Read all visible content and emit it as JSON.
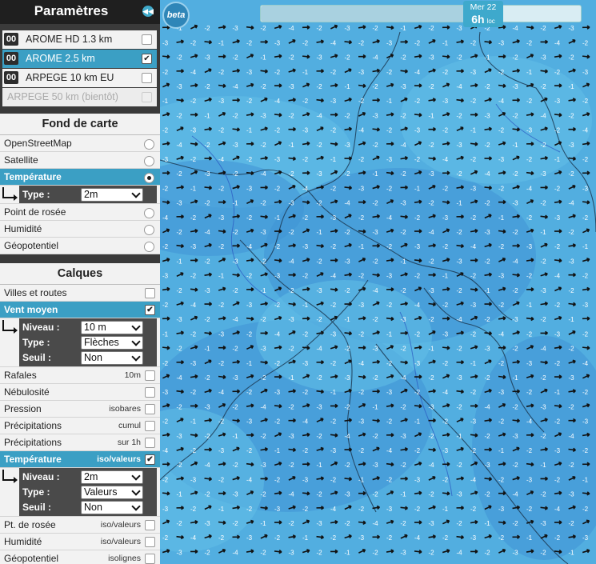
{
  "panel": {
    "title": "Paramètres",
    "models": [
      {
        "run": "00",
        "label": "AROME HD 1.3 km",
        "checked": false,
        "selected": false,
        "disabled": false
      },
      {
        "run": "00",
        "label": "AROME 2.5 km",
        "checked": true,
        "selected": true,
        "disabled": false
      },
      {
        "run": "00",
        "label": "ARPEGE 10 km EU",
        "checked": false,
        "selected": false,
        "disabled": false
      },
      {
        "run": "",
        "label": "ARPEGE 50 km (bientôt)",
        "checked": false,
        "selected": false,
        "disabled": true
      }
    ],
    "basemap": {
      "title": "Fond de carte",
      "options": [
        "OpenStreetMap",
        "Satellite",
        "Température",
        "Point de rosée",
        "Humidité",
        "Géopotentiel"
      ],
      "selected": "Température",
      "type_label": "Type :",
      "type_value": "2m"
    },
    "layers": {
      "title": "Calques",
      "villes": "Villes et routes",
      "vent": {
        "label": "Vent moyen",
        "niveau_label": "Niveau :",
        "niveau_value": "10 m",
        "type_label": "Type :",
        "type_value": "Flèches",
        "seuil_label": "Seuil :",
        "seuil_value": "Non"
      },
      "rafales": {
        "label": "Rafales",
        "hint": "10m"
      },
      "nebulosite": {
        "label": "Nébulosité",
        "hint": ""
      },
      "pression": {
        "label": "Pression",
        "hint": "isobares"
      },
      "precip_cumul": {
        "label": "Précipitations",
        "hint": "cumul"
      },
      "precip_1h": {
        "label": "Précipitations",
        "hint": "sur 1h"
      },
      "temperature": {
        "label": "Température",
        "hint": "iso/valeurs",
        "niveau_label": "Niveau :",
        "niveau_value": "2m",
        "type_label": "Type :",
        "type_value": "Valeurs",
        "seuil_label": "Seuil :",
        "seuil_value": "Non"
      },
      "pt_rosee": {
        "label": "Pt. de rosée",
        "hint": "iso/valeurs"
      },
      "humidite": {
        "label": "Humidité",
        "hint": "iso/valeurs"
      },
      "geopotentiel": {
        "label": "Géopotentiel",
        "hint": "isolignes"
      }
    }
  },
  "map": {
    "beta_badge": "beta",
    "date_day": "Mer 22",
    "date_hour": "6h",
    "date_tz": "loc",
    "temp_values": [
      "-2",
      "-1",
      "-2",
      "-3",
      "-2",
      "-4",
      "-2",
      "-3"
    ],
    "colors": {
      "sea": "#52aee0",
      "cold": "#3f94d6",
      "mild": "#62c0e8",
      "accent": "#3b9fc4"
    }
  }
}
